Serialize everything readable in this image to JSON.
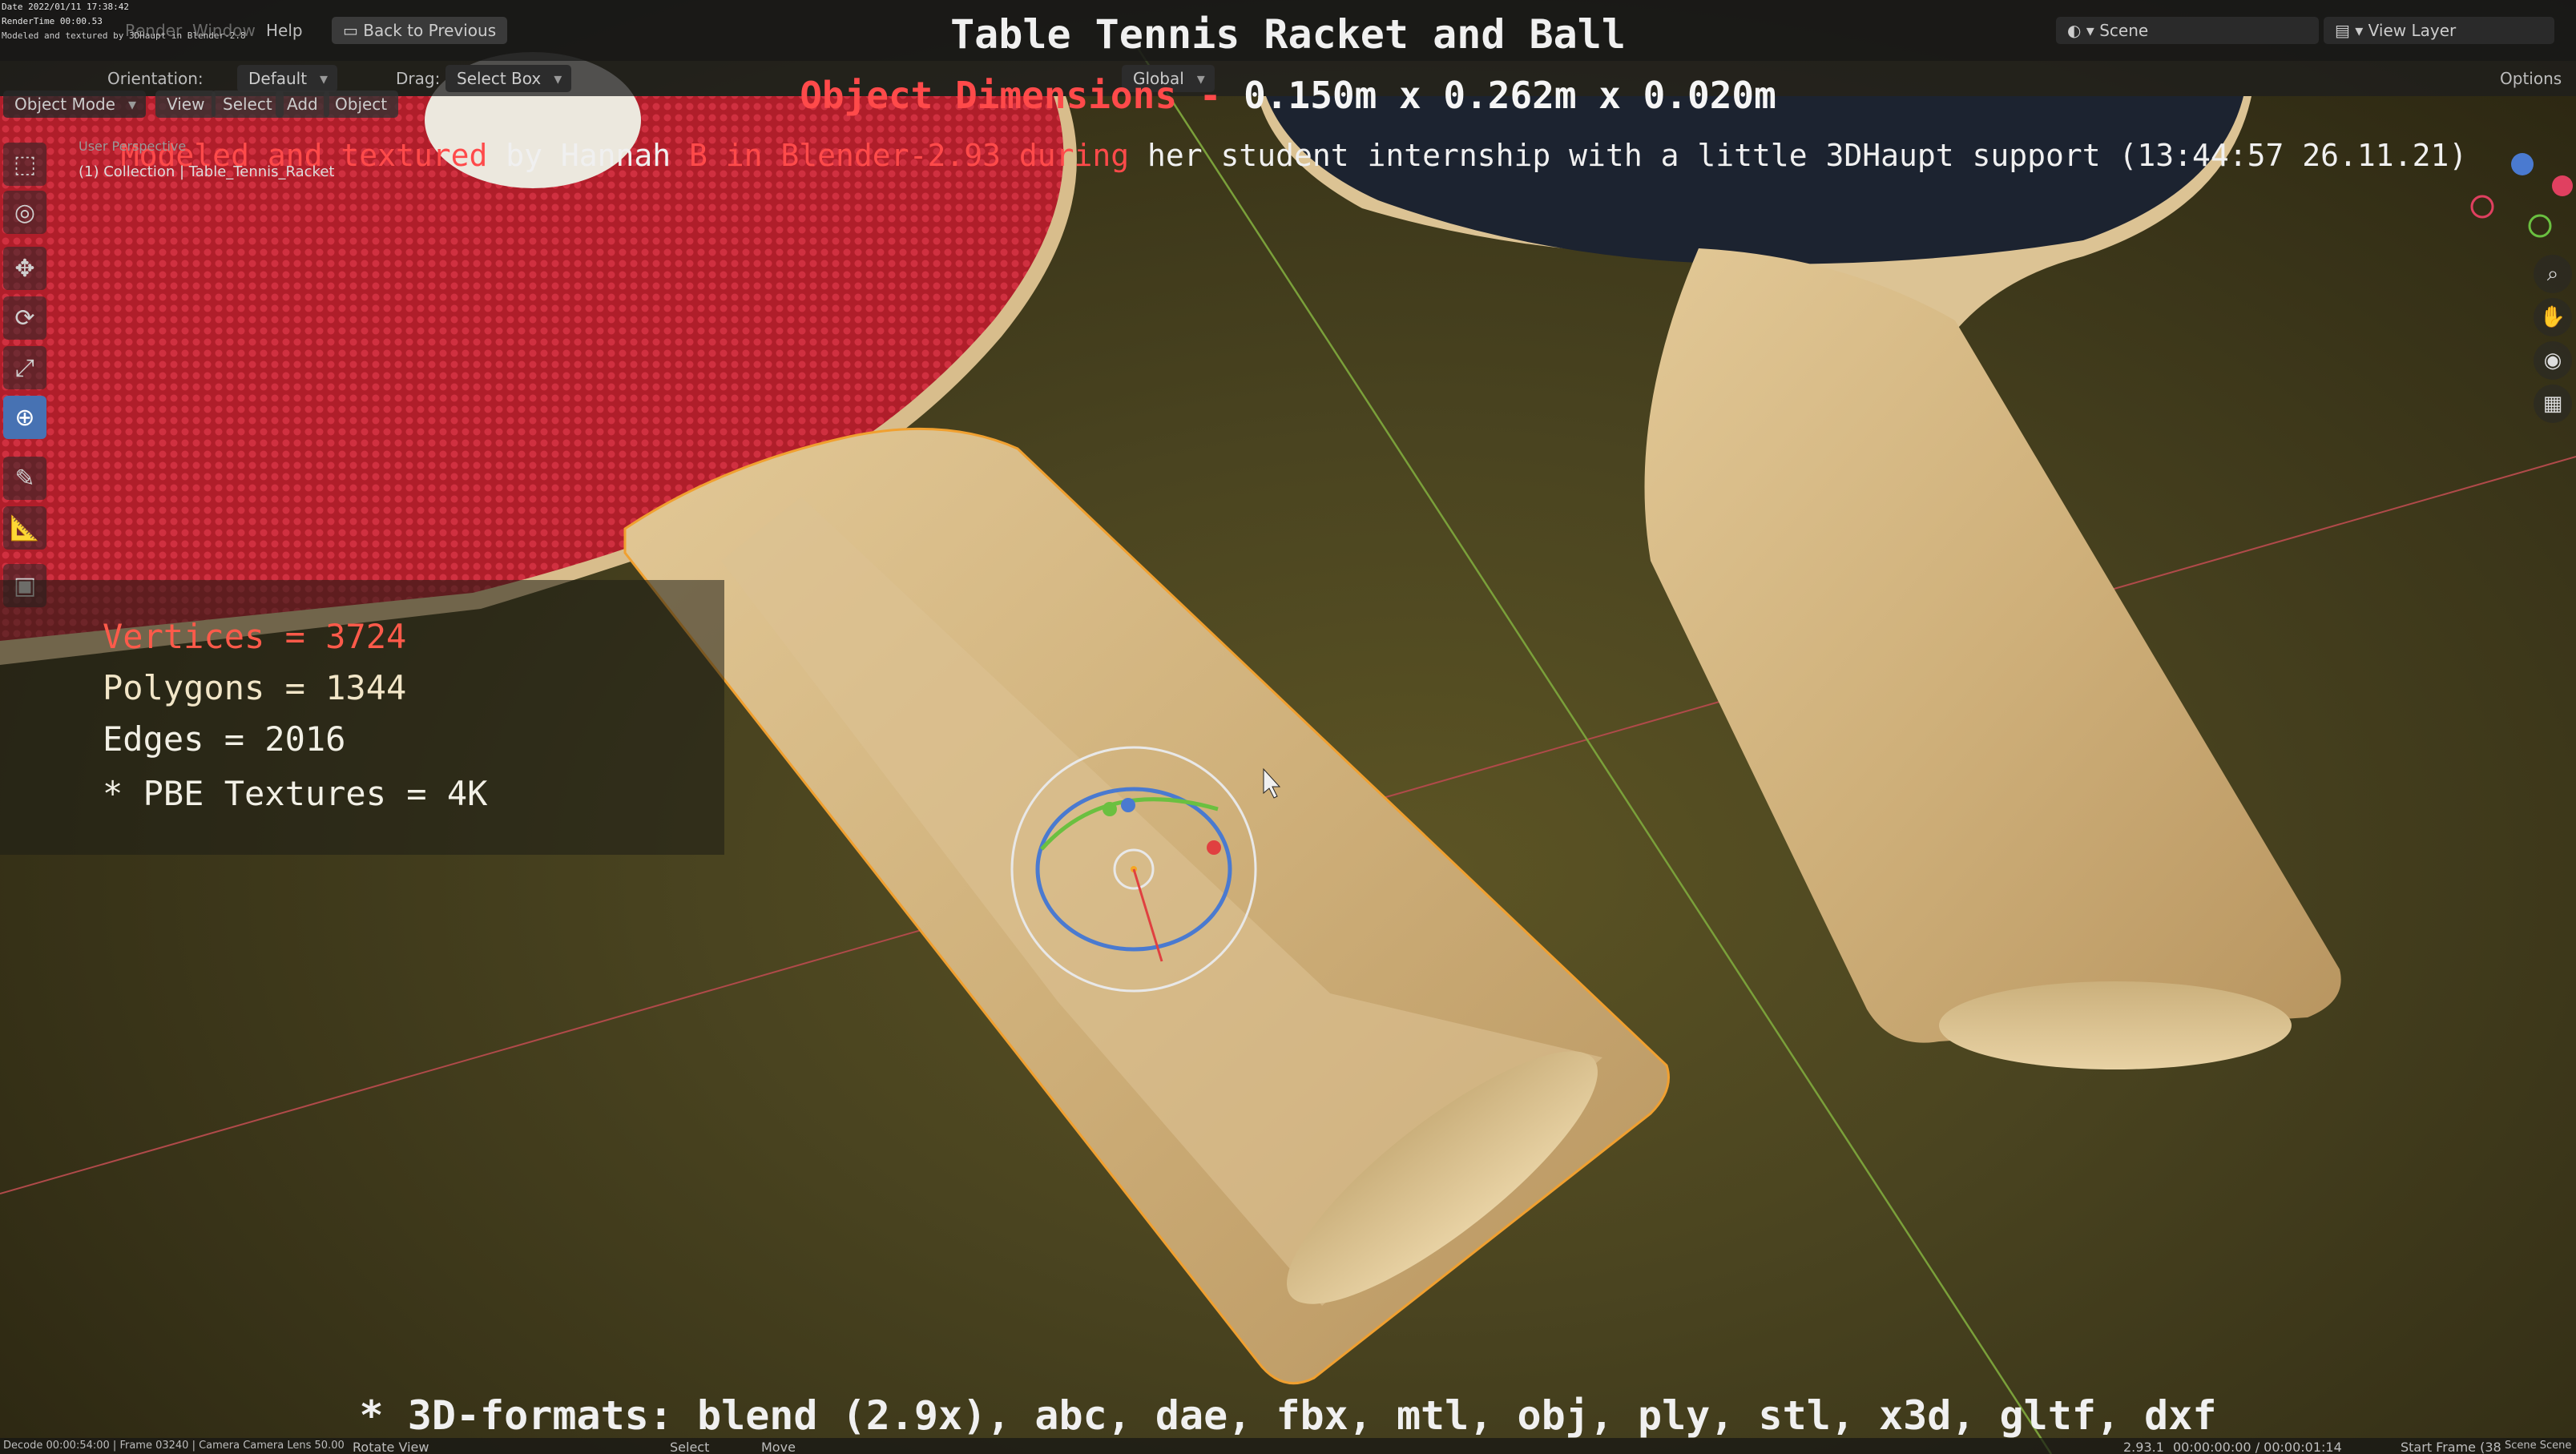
{
  "header": {
    "overlay_date": "Date 2022/01/11 17:38:42",
    "overlay_rendertime": "RenderTime 00:00.53",
    "overlay_modeled": "Modeled and textured by 3DHaupt in Blender-2.8",
    "menus": [
      "Render",
      "Window",
      "Help"
    ],
    "back_button": "Back to Previous",
    "scene_label": "Scene",
    "view_layer_label": "View Layer",
    "options_label": "Options"
  },
  "title": "Table Tennis Racket and Ball",
  "dimensions": {
    "label": "Object Dimensions -",
    "value": "0.150m x 0.262m x 0.020m"
  },
  "credit": {
    "part_red": "Modeled and textured",
    "part_white": " by Hannah ",
    "part_red2": "B in Blender-2.93 during",
    "part_white2": " her student internship with a little 3DHaupt support (13:44:57 26.11.21)"
  },
  "tool_settings": {
    "orientation_label": "Orientation:",
    "orientation_value": "Default",
    "drag_label": "Drag:",
    "drag_value": "Select Box",
    "transform_orientation": "Global"
  },
  "viewport_header": {
    "mode": "Object Mode",
    "menus": [
      "View",
      "Select",
      "Add",
      "Object"
    ]
  },
  "viewport_info": {
    "perspective": "User Perspective",
    "collection": "(1) Collection | Table_Tennis_Racket"
  },
  "stats": {
    "vertices": "Vertices = 3724",
    "polygons": "Polygons = 1344",
    "edges": "Edges = 2016",
    "textures": "* PBE Textures = 4K"
  },
  "formats": "* 3D-formats: blend (2.9x), abc, dae, fbx, mtl, obj, ply, stl, x3d, gltf, dxf",
  "statusbar": {
    "left": "Decode 00:00:54:00 | Frame 03240 | Camera Camera  Lens 50.00",
    "rotate": "Rotate View",
    "select": "Select",
    "move": "Move",
    "version": "2.93.1",
    "time": "00:00:00:00 / 00:00:01:14",
    "start_frame": "Start Frame (38",
    "scene": "Scene Scene"
  },
  "colors": {
    "accent_blue": "#4772b3",
    "title_red": "#ff4a4a",
    "rubber_red": "#b8202c",
    "wood": "#d9bd8a",
    "selection_orange": "#f5a623"
  },
  "icons": {
    "tools": [
      "select-box-icon",
      "cursor-icon",
      "move-icon",
      "rotate-icon",
      "scale-icon",
      "transform-icon",
      "annotate-icon",
      "measure-icon",
      "add-cube-icon"
    ],
    "navigation": [
      "zoom-icon",
      "hand-pan-icon",
      "camera-view-icon",
      "ortho-grid-icon"
    ]
  }
}
